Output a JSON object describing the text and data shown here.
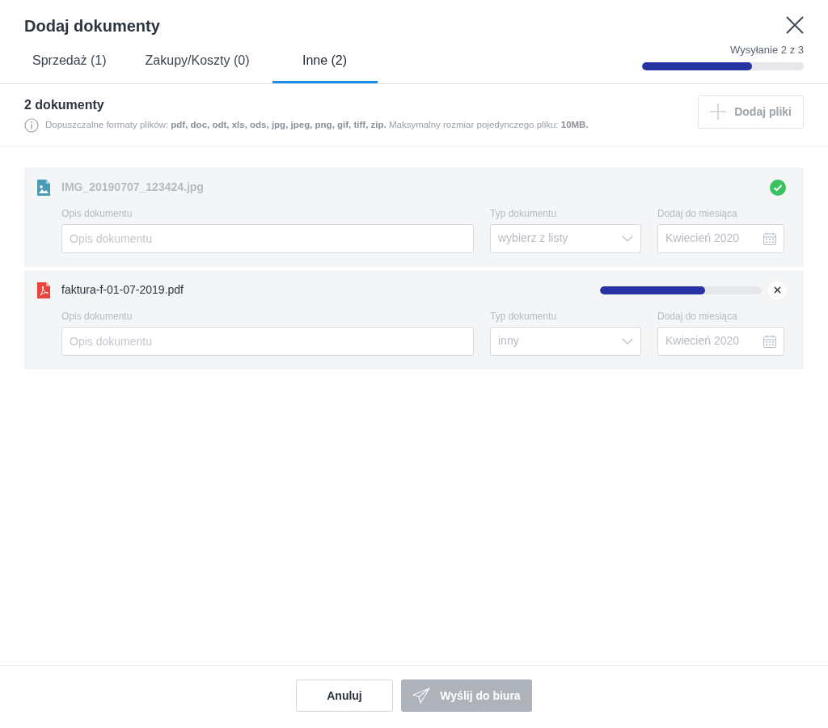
{
  "title": "Dodaj dokumenty",
  "tabs": [
    {
      "label": "Sprzedaż (1)",
      "selected": false
    },
    {
      "label": "Zakupy/Koszty (0)",
      "selected": false
    },
    {
      "label": "Inne (2)",
      "selected": true
    }
  ],
  "upload_status": {
    "label": "Wysyłanie 2 z 3",
    "level": 0.68
  },
  "summary": {
    "count": "2 dokumenty",
    "info": "Dopuszczalne formaty plików: **pdf, doc, odt, xls, ods, jpg, jpeg, png, gif, tiff, zip.** Maksymalny rozmiar pojedynczego pliku: **10MB.**"
  },
  "add_button": {
    "label": "Dodaj pliki",
    "disabled": true
  },
  "documents": [
    {
      "kind": "image",
      "name": "IMG_20190707_123424.jpg",
      "done": true,
      "description": {
        "label": "Opis dokumentu",
        "placeholder": "Opis dokumentu"
      },
      "type": {
        "label": "Typ dokumentu",
        "value": "wybierz z listy"
      },
      "month": {
        "label": "Dodaj do miesiąca",
        "value": "Kwiecień 2020"
      }
    },
    {
      "kind": "pdf",
      "name": "faktura-f-01-07-2019.pdf",
      "done": false,
      "level": 0.65,
      "description": {
        "label": "Opis dokumentu",
        "placeholder": "Opis dokumentu"
      },
      "type": {
        "label": "Typ dokumentu",
        "value": "inny"
      },
      "month": {
        "label": "Dodaj do miesiąca",
        "value": "Kwiecień 2020"
      }
    }
  ],
  "footer": {
    "cancel": "Anuluj",
    "send": {
      "label": "Wyślij do biura",
      "disabled": true
    }
  }
}
